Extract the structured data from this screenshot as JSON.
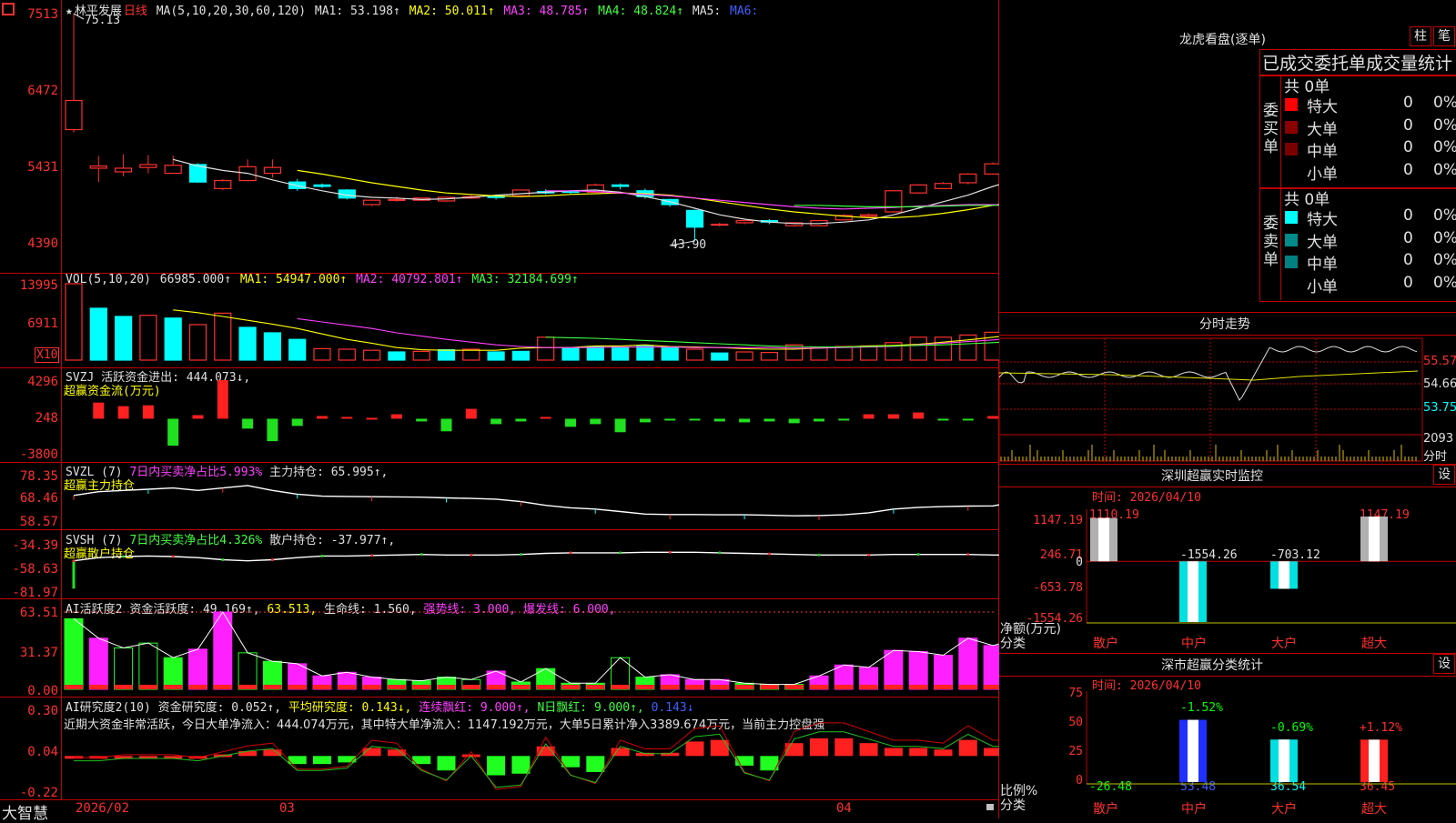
{
  "stock": {
    "name_line_prefix": "★",
    "name": "林平发展",
    "period": "日线",
    "ma_label": "MA(5,10,20,30,60,120)",
    "ma1": "MA1: 53.198↑",
    "ma2": "MA2: 50.011↑",
    "ma3": "MA3: 48.785↑",
    "ma4": "MA4: 48.824↑",
    "ma5": "MA5:",
    "ma6": "MA6:",
    "high_note": "75.13",
    "low_note": "43.90",
    "axis": [
      "7513",
      "6472",
      "5431",
      "4390"
    ]
  },
  "vol": {
    "label": "VOL(5,10,20)",
    "value": "66985.000↑",
    "ma1": "MA1: 54947.000↑",
    "ma2": "MA2: 40792.801↑",
    "ma3": "MA3: 32184.699↑",
    "axis": [
      "13995",
      "6911"
    ],
    "unit": "X10"
  },
  "svzj": {
    "label": "SVZJ",
    "desc": "活跃资金进出: 444.073↓,",
    "sub": "超赢资金流(万元)",
    "axis": [
      "4296",
      "248",
      "-3800"
    ]
  },
  "svzl": {
    "label": "SVZL (7)",
    "ratio": "7日内买卖净占比5.993%",
    "hold": "主力持仓: 65.995↑,",
    "sub": "超赢主力持仓",
    "axis": [
      "78.35",
      "68.46",
      "58.57"
    ]
  },
  "svsh": {
    "label": "SVSH (7)",
    "ratio": "7日内买卖净占比4.326%",
    "hold": "散户持仓: -37.977↑,",
    "sub": "超赢散户持仓",
    "axis": [
      "-34.39",
      "-58.63",
      "-81.97"
    ]
  },
  "ai_act": {
    "label": "AI活跃度2",
    "v1": "资金活跃度: 49.169↑,",
    "v2": "63.513,",
    "v3": "生命线: 1.560,",
    "v4": "强势线: 3.000,",
    "v5": "爆发线: 6.000,",
    "axis": [
      "63.51",
      "31.37",
      "0.00"
    ]
  },
  "ai_res": {
    "label": "AI研究度2(10)",
    "v1": "资金研究度: 0.052↑,",
    "v2": "平均研究度: 0.143↓,",
    "v3": "连续飘红: 9.000↑,",
    "v4": "N日飘红: 9.000↑,",
    "v5": "0.143↓",
    "comment": "近期大资金非常活跃，今日大单净流入：444.074万元，其中特大单净流入：1147.192万元，大单5日累计净入3389.674万元，当前主力控盘强",
    "axis": [
      "0.30",
      "0.04",
      "-0.22"
    ]
  },
  "bottom": {
    "brand": "大智慧",
    "dates": [
      "2026/02",
      "03",
      "04"
    ]
  },
  "longhu": {
    "title": "龙虎看盘(逐单)",
    "btn1": "柱",
    "btn2": "笔",
    "subtitle": "已成交委托单成交量统计",
    "buy_side": "委买单",
    "sell_side": "委卖单",
    "buy_total": "共 0单",
    "sell_total": "共 0单",
    "buy_rows": [
      {
        "label": "特大",
        "count": "0",
        "pct": "0%",
        "color": "#ff0000"
      },
      {
        "label": "大单",
        "count": "0",
        "pct": "0%",
        "color": "#8b0000"
      },
      {
        "label": "中单",
        "count": "0",
        "pct": "0%",
        "color": "#7a0000"
      },
      {
        "label": "小单",
        "count": "0",
        "pct": "0%",
        "color": ""
      }
    ],
    "sell_rows": [
      {
        "label": "特大",
        "count": "0",
        "pct": "0%",
        "color": "#00ffff"
      },
      {
        "label": "大单",
        "count": "0",
        "pct": "0%",
        "color": "#008b8b"
      },
      {
        "label": "中单",
        "count": "0",
        "pct": "0%",
        "color": "#008080"
      },
      {
        "label": "小单",
        "count": "0",
        "pct": "0%",
        "color": ""
      }
    ]
  },
  "intraday": {
    "title": "分时走势",
    "price_axis": [
      "55.57",
      "54.66",
      "53.75"
    ],
    "vol_axis": [
      "2093",
      "分时"
    ]
  },
  "monitor": {
    "title": "深圳超赢实时监控",
    "btn": "设",
    "time": "时间: 2026/04/10",
    "axis": [
      "1147.19",
      "246.71",
      "0",
      "-653.78",
      "-1554.26"
    ],
    "axis_label": "净额(万元)",
    "axis_label2": "分类",
    "values_text": [
      "1110.19",
      "-1554.26",
      "-703.12",
      "1147.19"
    ],
    "categories": [
      "散户",
      "中户",
      "大户",
      "超大"
    ]
  },
  "classify": {
    "title": "深市超赢分类统计",
    "btn": "设",
    "time": "时间: 2026/04/10",
    "axis": [
      "75",
      "50",
      "25",
      "0"
    ],
    "axis_label": "比例%",
    "axis_label2": "分类",
    "top_text": [
      "-1.52%",
      "-0.69%",
      "+1.12%"
    ],
    "bottom_text": [
      "-26.48",
      "53.48",
      "36.54",
      "36.45"
    ],
    "categories": [
      "散户",
      "中户",
      "大户",
      "超大"
    ]
  },
  "chart_data": [
    {
      "type": "candlestick",
      "name": "日线",
      "ylim": [
        43.9,
        75.13
      ],
      "candles": [
        {
          "o": 59.2,
          "c": 63.2,
          "h": 75.13,
          "l": 58.8
        },
        {
          "o": 53.9,
          "c": 54.2,
          "h": 55.6,
          "l": 52.0
        },
        {
          "o": 53.4,
          "c": 53.9,
          "h": 55.8,
          "l": 52.8
        },
        {
          "o": 54.0,
          "c": 54.4,
          "h": 55.7,
          "l": 53.2
        },
        {
          "o": 53.2,
          "c": 54.3,
          "h": 55.6,
          "l": 53.2
        },
        {
          "o": 54.4,
          "c": 52.0,
          "h": 54.6,
          "l": 51.9
        },
        {
          "o": 51.1,
          "c": 52.2,
          "h": 52.4,
          "l": 50.9
        },
        {
          "o": 52.2,
          "c": 54.1,
          "h": 55.1,
          "l": 52.1
        },
        {
          "o": 53.2,
          "c": 54.0,
          "h": 55.1,
          "l": 52.6
        },
        {
          "o": 52.0,
          "c": 51.1,
          "h": 52.4,
          "l": 50.8
        },
        {
          "o": 51.6,
          "c": 51.4,
          "h": 51.8,
          "l": 51.2
        },
        {
          "o": 50.9,
          "c": 49.8,
          "h": 51.0,
          "l": 49.6
        },
        {
          "o": 48.9,
          "c": 49.5,
          "h": 49.6,
          "l": 48.7
        },
        {
          "o": 49.6,
          "c": 49.6,
          "h": 50.0,
          "l": 49.3
        },
        {
          "o": 49.5,
          "c": 49.8,
          "h": 49.8,
          "l": 49.4
        },
        {
          "o": 49.4,
          "c": 49.9,
          "h": 50.0,
          "l": 49.3
        },
        {
          "o": 49.8,
          "c": 50.0,
          "h": 50.2,
          "l": 49.7
        },
        {
          "o": 50.0,
          "c": 49.9,
          "h": 50.3,
          "l": 49.6
        },
        {
          "o": 50.1,
          "c": 50.9,
          "h": 50.9,
          "l": 50.1
        },
        {
          "o": 50.7,
          "c": 50.5,
          "h": 51.0,
          "l": 50.3
        },
        {
          "o": 50.7,
          "c": 50.6,
          "h": 50.9,
          "l": 50.4
        },
        {
          "o": 50.6,
          "c": 51.6,
          "h": 51.8,
          "l": 50.6
        },
        {
          "o": 51.6,
          "c": 51.4,
          "h": 51.8,
          "l": 51.0
        },
        {
          "o": 50.8,
          "c": 50.0,
          "h": 51.1,
          "l": 49.7
        },
        {
          "o": 49.6,
          "c": 48.9,
          "h": 49.7,
          "l": 48.6
        },
        {
          "o": 48.1,
          "c": 45.8,
          "h": 48.2,
          "l": 43.9
        },
        {
          "o": 46.1,
          "c": 46.2,
          "h": 46.4,
          "l": 45.9
        },
        {
          "o": 46.4,
          "c": 46.7,
          "h": 46.8,
          "l": 46.2
        },
        {
          "o": 46.7,
          "c": 46.5,
          "h": 46.9,
          "l": 46.2
        },
        {
          "o": 46.0,
          "c": 46.4,
          "h": 46.5,
          "l": 45.9
        },
        {
          "o": 46.0,
          "c": 46.7,
          "h": 46.8,
          "l": 45.9
        },
        {
          "o": 46.8,
          "c": 47.4,
          "h": 47.6,
          "l": 46.7
        },
        {
          "o": 47.3,
          "c": 47.5,
          "h": 47.7,
          "l": 47.1
        },
        {
          "o": 47.9,
          "c": 50.8,
          "h": 50.9,
          "l": 47.8
        },
        {
          "o": 50.5,
          "c": 51.6,
          "h": 51.7,
          "l": 50.4
        },
        {
          "o": 51.1,
          "c": 51.8,
          "h": 52.0,
          "l": 51.1
        },
        {
          "o": 51.9,
          "c": 53.1,
          "h": 53.2,
          "l": 51.7
        },
        {
          "o": 53.1,
          "c": 54.5,
          "h": 54.7,
          "l": 53.1
        },
        {
          "o": 55.0,
          "c": 56.3,
          "h": 56.4,
          "l": 54.9
        }
      ],
      "series": [
        {
          "name": "MA1",
          "color": "#e0e0e0",
          "start": 4,
          "values": [
            55.1,
            54.2,
            53.6,
            53.2,
            52.3,
            51.5,
            50.8,
            50.2,
            49.9,
            49.8,
            49.6,
            49.7,
            49.9,
            50.2,
            50.4,
            50.6,
            50.8,
            50.9,
            50.6,
            50.0,
            49.3,
            48.4,
            47.5,
            46.9,
            46.5,
            46.3,
            46.3,
            46.5,
            46.8,
            47.5,
            48.4,
            49.3,
            50.2,
            51.4,
            52.4,
            53.6
          ]
        },
        {
          "name": "MA2",
          "color": "#ffff00",
          "start": 9,
          "values": [
            53.6,
            53.1,
            52.5,
            51.9,
            51.4,
            50.9,
            50.5,
            50.3,
            50.1,
            50.0,
            50.1,
            50.3,
            50.4,
            50.5,
            50.4,
            50.2,
            49.8,
            49.3,
            48.8,
            48.3,
            47.9,
            47.6,
            47.3,
            47.1,
            47.1,
            47.3,
            47.7,
            48.2,
            48.8,
            49.4,
            50.2
          ]
        },
        {
          "name": "MA3",
          "color": "#ff40ff",
          "start": 19,
          "values": [
            50.8,
            50.8,
            50.7,
            50.5,
            50.3,
            50.1,
            49.8,
            49.5,
            49.2,
            48.9,
            48.6,
            48.4,
            48.3,
            48.4,
            48.5,
            48.7,
            48.8,
            48.9,
            48.9,
            48.8
          ]
        },
        {
          "name": "MA4",
          "color": "#40ff40",
          "start": 29,
          "values": [
            48.8,
            48.8,
            48.7,
            48.6,
            48.6,
            48.6,
            48.7,
            48.8,
            48.8,
            48.8
          ]
        }
      ]
    },
    {
      "type": "bar",
      "name": "VOL",
      "ylim": [
        0,
        13995
      ],
      "values": [
        13995,
        9500,
        8000,
        8200,
        7700,
        6500,
        8600,
        6000,
        5000,
        3800,
        2100,
        2000,
        1800,
        1500,
        1600,
        1900,
        2000,
        1500,
        1600,
        4200,
        2200,
        2500,
        2400,
        2600,
        2300,
        2000,
        1300,
        1500,
        1400,
        2800,
        2300,
        2500,
        2600,
        3200,
        4200,
        4200,
        4600,
        5100,
        5700,
        6400
      ],
      "rise": [
        1,
        0,
        0,
        1,
        0,
        1,
        1,
        0,
        0,
        0,
        1,
        1,
        1,
        0,
        1,
        0,
        1,
        0,
        0,
        1,
        0,
        0,
        0,
        0,
        0,
        1,
        0,
        1,
        1,
        1,
        1,
        1,
        1,
        1,
        1,
        1,
        1,
        1,
        1,
        1
      ],
      "series": [
        {
          "name": "MA1",
          "color": "#ffff00",
          "start": 4,
          "values": [
            9200,
            8700,
            8000,
            7300,
            6600,
            5800,
            4800,
            3800,
            3100,
            2300,
            1900,
            1800,
            1800,
            1800,
            2200,
            2300,
            2300,
            2600,
            2600,
            2800,
            2500,
            2400,
            2300,
            2100,
            2000,
            2000,
            2200,
            2400,
            2600,
            2700,
            2900,
            3300,
            3700,
            4200,
            4700,
            5300
          ]
        },
        {
          "name": "MA2",
          "color": "#ff40ff",
          "start": 9,
          "values": [
            7600,
            7000,
            6400,
            5800,
            5000,
            4400,
            3800,
            3300,
            2800,
            2500,
            2300,
            2300,
            2300,
            2400,
            2400,
            2400,
            2300,
            2300,
            2300,
            2300,
            2200,
            2200,
            2300,
            2400,
            2500,
            2800,
            3100,
            3400,
            3700,
            4000,
            4500
          ]
        },
        {
          "name": "MA3",
          "color": "#40ff40",
          "start": 19,
          "values": [
            4200,
            4100,
            4000,
            3800,
            3600,
            3400,
            3200,
            3000,
            2800,
            2600,
            2500,
            2400,
            2400,
            2500,
            2600,
            2700,
            2800,
            3000,
            3200,
            3500
          ]
        }
      ]
    },
    {
      "type": "bar",
      "name": "超赢资金流(万元)",
      "ylim": [
        -3800,
        4296
      ],
      "values": [
        0,
        1800,
        1400,
        1500,
        -3000,
        400,
        4296,
        -1100,
        -2500,
        -800,
        300,
        200,
        100,
        500,
        -300,
        -1400,
        1100,
        -600,
        -300,
        200,
        -900,
        -600,
        -1500,
        -400,
        -200,
        -100,
        -300,
        -400,
        -300,
        -500,
        -300,
        -200,
        500,
        500,
        700,
        -200,
        -100,
        300,
        2300,
        400
      ]
    },
    {
      "type": "line",
      "name": "超赢主力持仓",
      "ylim": [
        58.57,
        78.35
      ],
      "values": [
        70.0,
        71.5,
        72.0,
        72.5,
        73.0,
        72.0,
        73.0,
        74.0,
        72.0,
        70.5,
        69.7,
        69.6,
        69.5,
        69.4,
        69.3,
        69.0,
        68.8,
        68.5,
        67.5,
        66.0,
        65.0,
        64.5,
        63.5,
        62.5,
        62.3,
        62.3,
        62.2,
        62.2,
        62.0,
        61.8,
        61.9,
        62.2,
        63.0,
        64.5,
        65.2,
        65.5,
        65.7,
        65.8,
        67.5,
        66.0
      ]
    },
    {
      "type": "line",
      "name": "超赢散户持仓",
      "ylim": [
        -81.97,
        -34.39
      ],
      "values": [
        -52.0,
        -49.0,
        -48.0,
        -47.5,
        -48.0,
        -49.0,
        -51.0,
        -52.0,
        -51.0,
        -49.0,
        -47.5,
        -47.5,
        -47.0,
        -46.5,
        -46.0,
        -46.5,
        -46.5,
        -46.5,
        -46.0,
        -45.0,
        -44.5,
        -44.5,
        -44.5,
        -44.0,
        -44.0,
        -44.0,
        -44.5,
        -45.0,
        -45.5,
        -46.0,
        -46.5,
        -46.5,
        -46.5,
        -46.0,
        -46.0,
        -46.0,
        -46.0,
        -46.5,
        -46.5,
        -46.0
      ]
    },
    {
      "type": "bar",
      "name": "AI活跃度2",
      "ylim": [
        0,
        63.51
      ],
      "values": [
        58,
        42,
        34,
        38,
        26,
        33,
        63.5,
        30,
        23,
        21,
        11,
        14,
        10,
        8,
        7,
        10,
        8,
        15,
        6,
        17,
        5,
        5,
        26,
        10,
        12,
        8,
        8,
        5,
        4,
        4,
        11,
        20,
        18,
        32,
        31,
        28,
        42,
        36,
        41,
        46
      ],
      "flag": [
        2,
        1,
        0,
        0,
        2,
        1,
        1,
        0,
        2,
        1,
        1,
        1,
        1,
        2,
        2,
        2,
        0,
        1,
        2,
        2,
        2,
        2,
        0,
        2,
        1,
        1,
        1,
        2,
        2,
        2,
        1,
        1,
        1,
        1,
        1,
        1,
        1,
        1,
        1,
        1
      ]
    },
    {
      "type": "bar",
      "name": "AI研究度2(10)",
      "ylim": [
        -0.22,
        0.3
      ],
      "values": [
        0.0,
        0.0,
        0.01,
        0.01,
        0.01,
        0.0,
        0.02,
        0.04,
        0.05,
        -0.04,
        -0.04,
        -0.03,
        0.06,
        0.05,
        -0.04,
        -0.08,
        0.02,
        -0.11,
        -0.1,
        0.07,
        -0.06,
        -0.09,
        0.06,
        0.03,
        0.03,
        0.1,
        0.11,
        -0.05,
        -0.08,
        0.09,
        0.12,
        0.12,
        0.09,
        0.06,
        0.06,
        0.05,
        0.11,
        0.06,
        0.06,
        0.05
      ]
    },
    {
      "type": "bar",
      "name": "深圳超赢实时监控",
      "categories": [
        "散户",
        "中户",
        "大户",
        "超大"
      ],
      "values": [
        1110.19,
        -1554.26,
        -703.12,
        1147.19
      ],
      "ylim": [
        -1554.26,
        1147.19
      ]
    },
    {
      "type": "bar",
      "name": "深市超赢分类统计",
      "categories": [
        "散户",
        "中户",
        "大户",
        "超大"
      ],
      "values": [
        0,
        53.48,
        36.54,
        36.45
      ],
      "ylim": [
        0,
        75
      ]
    }
  ]
}
